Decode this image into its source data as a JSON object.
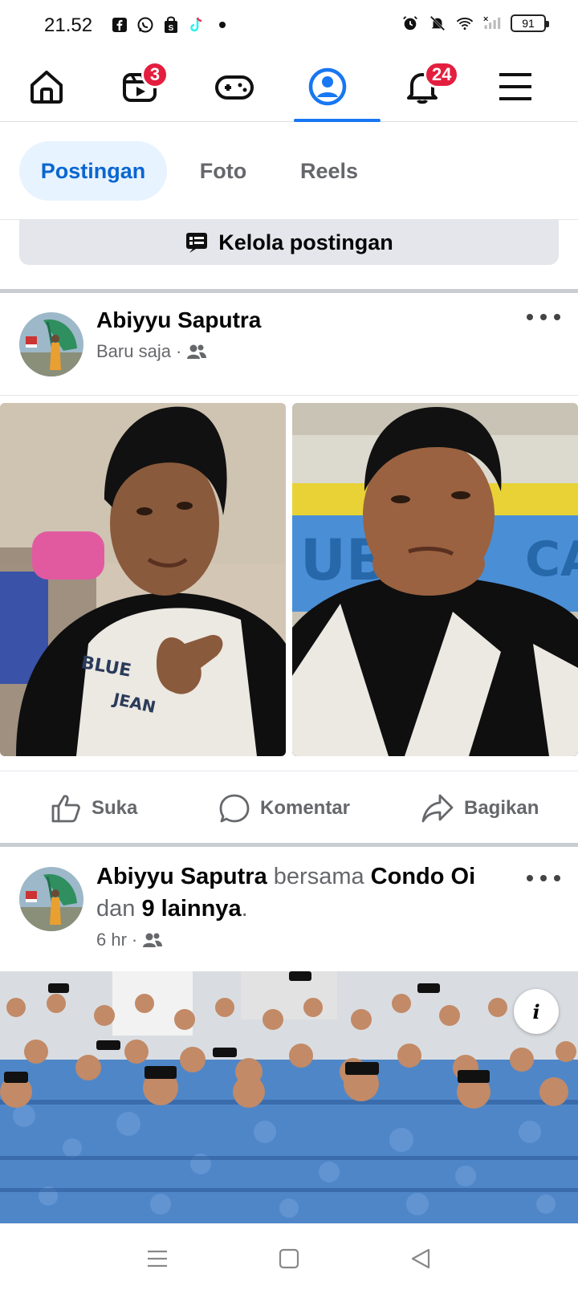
{
  "status_bar": {
    "time": "21.52",
    "battery": "91",
    "icons_left": [
      "facebook-icon",
      "whatsapp-icon",
      "shop-bag-icon",
      "tiktok-icon",
      "dot-icon"
    ],
    "icons_right": [
      "alarm-icon",
      "mute-bell-icon",
      "wifi-icon",
      "signal-icon",
      "battery-icon"
    ]
  },
  "top_nav": {
    "items": [
      {
        "name": "home",
        "icon": "home-icon"
      },
      {
        "name": "video",
        "icon": "video-icon",
        "badge": "3"
      },
      {
        "name": "gaming",
        "icon": "gamepad-icon"
      },
      {
        "name": "profile",
        "icon": "profile-icon",
        "active": true
      },
      {
        "name": "notifications",
        "icon": "bell-icon",
        "badge": "24"
      },
      {
        "name": "menu",
        "icon": "hamburger-icon"
      }
    ],
    "accent": "#1877f2",
    "badge_color": "#e41e3f"
  },
  "tabs": [
    {
      "label": "Postingan",
      "active": true
    },
    {
      "label": "Foto",
      "active": false
    },
    {
      "label": "Reels",
      "active": false
    }
  ],
  "manage": {
    "label": "Kelola postingan"
  },
  "post1": {
    "author": "Abiyyu Saputra",
    "time": "Baru saja",
    "separator": "·",
    "audience_icon": "friends-icon"
  },
  "actions": {
    "like": "Suka",
    "comment": "Komentar",
    "share": "Bagikan"
  },
  "post2": {
    "author": "Abiyyu Saputra",
    "with_word": "bersama",
    "tagged": "Condo Oi",
    "and_word": "dan",
    "others": "9 lainnya",
    "period": ".",
    "time": "6 hr",
    "separator": "·",
    "info": "i"
  },
  "system_nav": {
    "items": [
      "recents-icon",
      "home-square-icon",
      "back-triangle-icon"
    ]
  }
}
